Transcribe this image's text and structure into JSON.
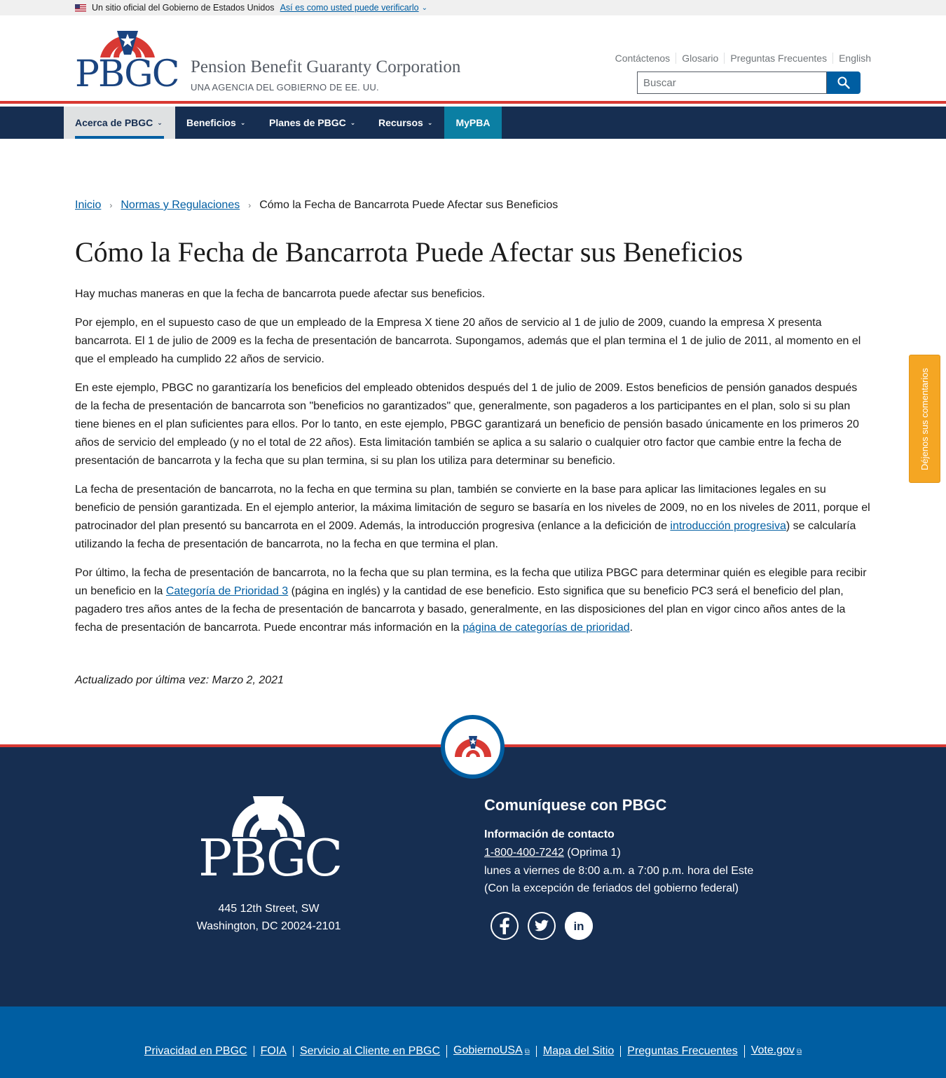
{
  "banner": {
    "official_text": "Un sitio oficial del Gobierno de Estados Unidos",
    "verify_link": "Así es como usted puede verificarlo"
  },
  "header": {
    "logo_text": "PBGC",
    "agency_name": "Pension Benefit Guaranty Corporation",
    "agency_sub": "UNA AGENCIA DEL GOBIERNO DE EE. UU.",
    "util_links": [
      "Contáctenos",
      "Glosario",
      "Preguntas Frecuentes",
      "English"
    ],
    "search_placeholder": "Buscar"
  },
  "nav": {
    "items": [
      "Acerca de PBGC",
      "Beneficios",
      "Planes de PBGC",
      "Recursos",
      "MyPBA"
    ]
  },
  "breadcrumb": [
    "Inicio",
    "Normas y Regulaciones",
    "Cómo la Fecha de Bancarrota Puede Afectar sus Beneficios"
  ],
  "page": {
    "title": "Cómo la Fecha de Bancarrota Puede Afectar sus Beneficios",
    "p1": "Hay muchas maneras en que la fecha de bancarrota puede afectar sus beneficios.",
    "p2": "Por ejemplo, en el supuesto caso de que un empleado de la Empresa X tiene 20 años de servicio al 1 de julio de 2009, cuando la empresa X presenta bancarrota. El 1 de julio de 2009 es la fecha de presentación de bancarrota. Supongamos, además que el plan termina el 1 de julio de 2011, al momento en el que el empleado ha cumplido 22 años de servicio.",
    "p3": "En este ejemplo, PBGC no garantizaría los beneficios del empleado obtenidos después del 1 de julio de 2009. Estos beneficios de pensión ganados después de la fecha de presentación de bancarrota son \"beneficios no garantizados\" que, generalmente, son pagaderos a los participantes en el plan, solo si su plan tiene bienes en el plan suficientes para ellos. Por lo tanto, en este ejemplo, PBGC garantizará un beneficio de pensión basado únicamente en los primeros 20 años de servicio del empleado (y no el total de 22 años). Esta limitación también se aplica a su salario o cualquier otro factor que cambie entre la fecha de presentación de bancarrota y la fecha que su plan termina, si su plan los utiliza para determinar su beneficio.",
    "p4_a": "La fecha de presentación de bancarrota, no la fecha en que termina su plan, también se convierte en la base para aplicar las limitaciones legales en su beneficio de pensión garantizada. En el ejemplo anterior, la máxima limitación de seguro se basaría en los niveles de 2009, no en los niveles de 2011, porque el patrocinador del plan presentó su bancarrota en el 2009. Además, la introducción progresiva (enlance a la deficición de ",
    "p4_link": "introducción progresiva",
    "p4_b": ") se calcularía utilizando la fecha de presentación de bancarrota, no la fecha en que termina el plan.",
    "p5_a": "Por último, la fecha de presentación de bancarrota, no la fecha que su plan termina, es la fecha que utiliza PBGC para determinar quién es elegible para recibir un beneficio en la ",
    "p5_link1": "Categoría de Prioridad 3",
    "p5_b": " (página en inglés) y la cantidad de ese beneficio. Esto significa que su beneficio PC3 será el beneficio del plan, pagadero tres años antes de la fecha de presentación de bancarrota y basado, generalmente, en las disposiciones del plan en vigor cinco años antes de la fecha de presentación de bancarrota. Puede encontrar más información en la ",
    "p5_link2": "página de categorías de prioridad",
    "p5_c": ".",
    "updated": "Actualizado por última vez: Marzo 2, 2021"
  },
  "feedback_tab": "Déjenos sus comentarios",
  "footer": {
    "logo_text": "PBGC",
    "address_line1": "445 12th Street, SW",
    "address_line2": "Washington, DC 20024-2101",
    "contact_heading": "Comuníquese con PBGC",
    "contact_label": "Información de contacto",
    "phone": "1-800-400-7242",
    "phone_note": " (Oprima 1)",
    "hours": "lunes a viernes de 8:00 a.m. a 7:00 p.m. hora del Este",
    "holidays": "(Con la excepción de feriados del gobierno federal)",
    "social": [
      "facebook-icon",
      "twitter-icon",
      "linkedin-icon"
    ],
    "bottom_links": [
      "Privacidad en PBGC",
      "FOIA",
      "Servicio al Cliente en PBGC",
      "GobiernoUSA",
      "Mapa del Sitio",
      "Preguntas Frecuentes",
      "Vote.gov"
    ]
  },
  "colors": {
    "navy": "#162e51",
    "blue": "#005ea2",
    "red": "#d83933",
    "mypba": "#0b7fa3",
    "feedback": "#f5a623"
  }
}
